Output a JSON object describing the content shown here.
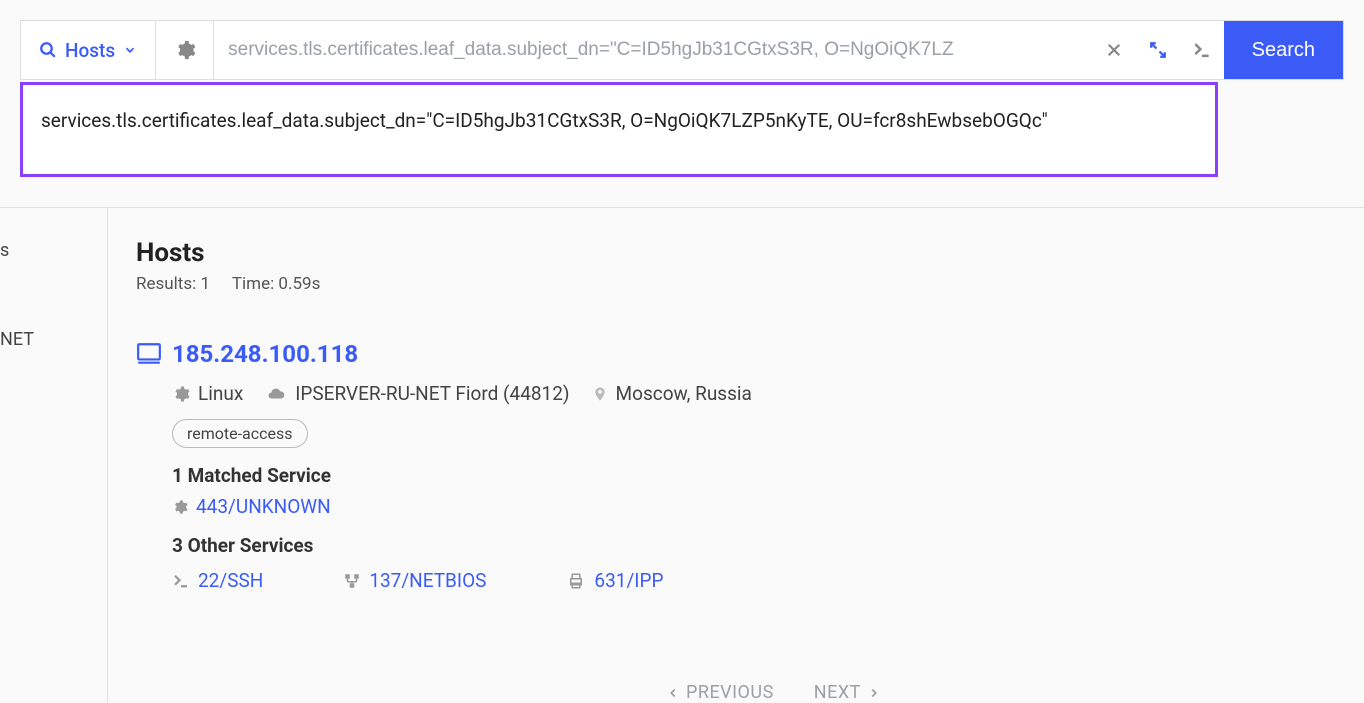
{
  "searchbar": {
    "hosts_label": "Hosts",
    "query_placeholder": "services.tls.certificates.leaf_data.subject_dn=\"C=ID5hgJb31CGtxS3R, O=NgOiQK7LZ",
    "search_label": "Search"
  },
  "expanded_query": "services.tls.certificates.leaf_data.subject_dn=\"C=ID5hgJb31CGtxS3R, O=NgOiQK7LZP5nKyTE, OU=fcr8shEwbsebOGQc\"",
  "sidebar": {
    "item_s": "s",
    "item_net": "NET"
  },
  "results": {
    "title": "Hosts",
    "results_label": "Results: 1",
    "time_label": "Time: 0.59s"
  },
  "host": {
    "ip": "185.248.100.118",
    "os": "Linux",
    "asn": "IPSERVER-RU-NET Fiord (44812)",
    "location": "Moscow, Russia",
    "tag": "remote-access",
    "matched_heading": "1 Matched Service",
    "matched_service": "443/UNKNOWN",
    "other_heading": "3 Other Services",
    "svc_ssh": "22/SSH",
    "svc_netbios": "137/NETBIOS",
    "svc_ipp": "631/IPP"
  },
  "pager": {
    "prev": "PREVIOUS",
    "next": "NEXT"
  }
}
